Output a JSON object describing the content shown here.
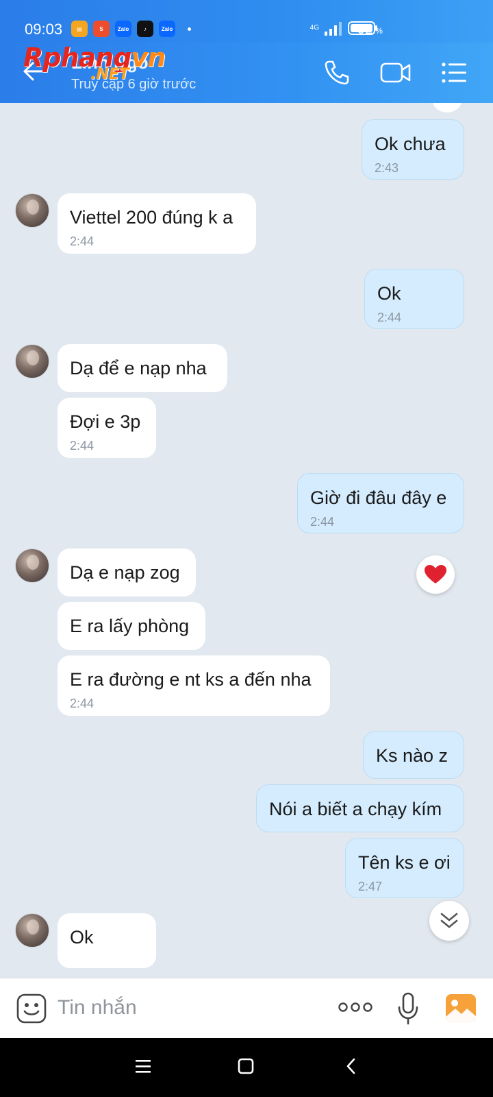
{
  "status_bar": {
    "time": "09:03",
    "network": "4G",
    "battery_percent": "92",
    "battery_unit": "%",
    "app_icons": [
      "files-app-icon",
      "shopee-icon",
      "zalo-icon",
      "tiktok-icon",
      "zalo-icon"
    ]
  },
  "header": {
    "contact_name": "Linh Ngo",
    "status": "Truy cập 6 giờ trước",
    "watermark_part1": "Rphang",
    "watermark_part2": "vn",
    "watermark_suffix": ".NET"
  },
  "messages": [
    {
      "dir": "out",
      "text": "Ok chưa",
      "time": "2:43"
    },
    {
      "dir": "in",
      "text": "Viettel 200 đúng k a",
      "time": "2:44"
    },
    {
      "dir": "out",
      "text": "Ok",
      "time": "2:44"
    },
    {
      "dir": "in",
      "text": "Dạ để e nạp nha",
      "time": ""
    },
    {
      "dir": "in",
      "text": "Đợi e 3p",
      "time": "2:44"
    },
    {
      "dir": "out",
      "text": "Giờ đi đâu đây e",
      "time": "2:44"
    },
    {
      "dir": "in",
      "text": "Dạ e nạp zog",
      "time": ""
    },
    {
      "dir": "in",
      "text": "E ra lấy phòng",
      "time": ""
    },
    {
      "dir": "in",
      "text": "E ra đường e nt ks a đến nha",
      "time": "2:44"
    },
    {
      "dir": "out",
      "text": "Ks nào z",
      "time": ""
    },
    {
      "dir": "out",
      "text": "Nói a biết a chạy kím",
      "time": ""
    },
    {
      "dir": "out",
      "text": "Tên ks e ơi",
      "time": "2:47"
    },
    {
      "dir": "in",
      "text": "Ok",
      "time": ""
    }
  ],
  "input": {
    "placeholder": "Tin nhắn"
  },
  "colors": {
    "header_blue": "#2f8ef0",
    "incoming_bubble": "#ffffff",
    "outgoing_bubble": "#d4ecfd",
    "chat_background": "#e2e8ef",
    "heart": "#e0212f"
  }
}
